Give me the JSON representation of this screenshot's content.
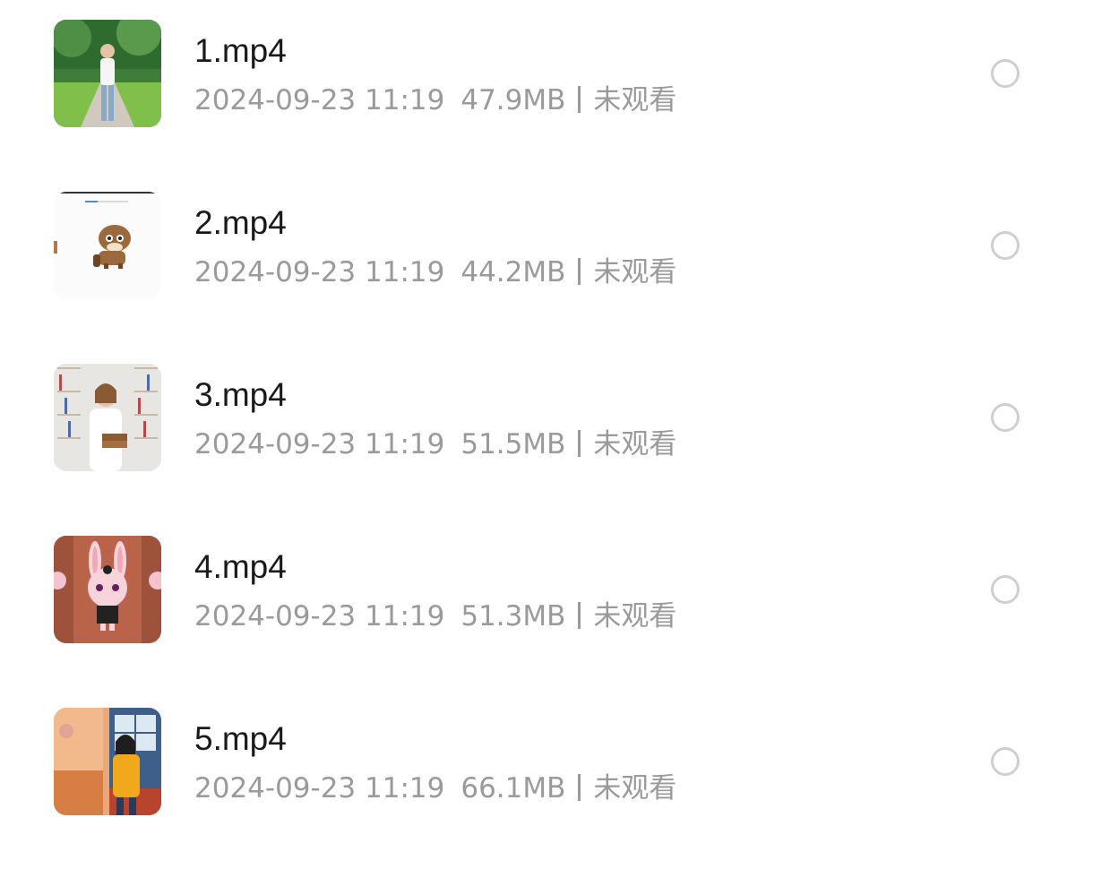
{
  "files": [
    {
      "name": "1.mp4",
      "date": "2024-09-23 11:19",
      "size": "47.9MB",
      "status": "未观看",
      "thumbnail_icon": "woman-in-park-thumbnail"
    },
    {
      "name": "2.mp4",
      "date": "2024-09-23 11:19",
      "size": "44.2MB",
      "status": "未观看",
      "thumbnail_icon": "cartoon-horse-thumbnail"
    },
    {
      "name": "3.mp4",
      "date": "2024-09-23 11:19",
      "size": "51.5MB",
      "status": "未观看",
      "thumbnail_icon": "woman-bookshelf-thumbnail"
    },
    {
      "name": "4.mp4",
      "date": "2024-09-23 11:19",
      "size": "51.3MB",
      "status": "未观看",
      "thumbnail_icon": "cartoon-bunny-thumbnail"
    },
    {
      "name": "5.mp4",
      "date": "2024-09-23 11:19",
      "size": "66.1MB",
      "status": "未观看",
      "thumbnail_icon": "girl-yellow-shirt-thumbnail"
    }
  ],
  "colors": {
    "title": "#1a1a1a",
    "meta": "#9a9a9a",
    "radio_border": "#cfcfcf"
  }
}
